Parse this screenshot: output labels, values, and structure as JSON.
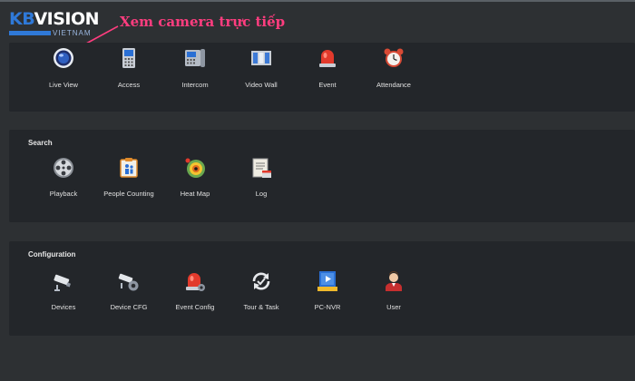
{
  "logo": {
    "brand_kb": "KB",
    "brand_vision": "VISION",
    "brand_sub": "VIETNAM"
  },
  "annotation": "Xem camera trực tiếp",
  "colors": {
    "background": "#2d3033",
    "panel": "#23262a",
    "annotation": "#ff3d7f",
    "brand_blue": "#2f79d8"
  },
  "main": {
    "tiles": [
      {
        "label": "Live View",
        "icon": "live-view-icon"
      },
      {
        "label": "Access",
        "icon": "access-icon"
      },
      {
        "label": "Intercom",
        "icon": "intercom-icon"
      },
      {
        "label": "Video Wall",
        "icon": "video-wall-icon"
      },
      {
        "label": "Event",
        "icon": "event-alarm-icon"
      },
      {
        "label": "Attendance",
        "icon": "alarm-clock-icon"
      }
    ]
  },
  "search": {
    "title": "Search",
    "tiles": [
      {
        "label": "Playback",
        "icon": "film-reel-icon"
      },
      {
        "label": "People Counting",
        "icon": "people-counting-icon"
      },
      {
        "label": "Heat Map",
        "icon": "heat-map-icon"
      },
      {
        "label": "Log",
        "icon": "log-icon"
      }
    ]
  },
  "configuration": {
    "title": "Configuration",
    "tiles": [
      {
        "label": "Devices",
        "icon": "camera-device-icon"
      },
      {
        "label": "Device CFG",
        "icon": "camera-config-icon"
      },
      {
        "label": "Event Config",
        "icon": "event-config-icon"
      },
      {
        "label": "Tour & Task",
        "icon": "tour-task-icon"
      },
      {
        "label": "PC-NVR",
        "icon": "pc-nvr-icon"
      },
      {
        "label": "User",
        "icon": "user-icon"
      }
    ]
  }
}
